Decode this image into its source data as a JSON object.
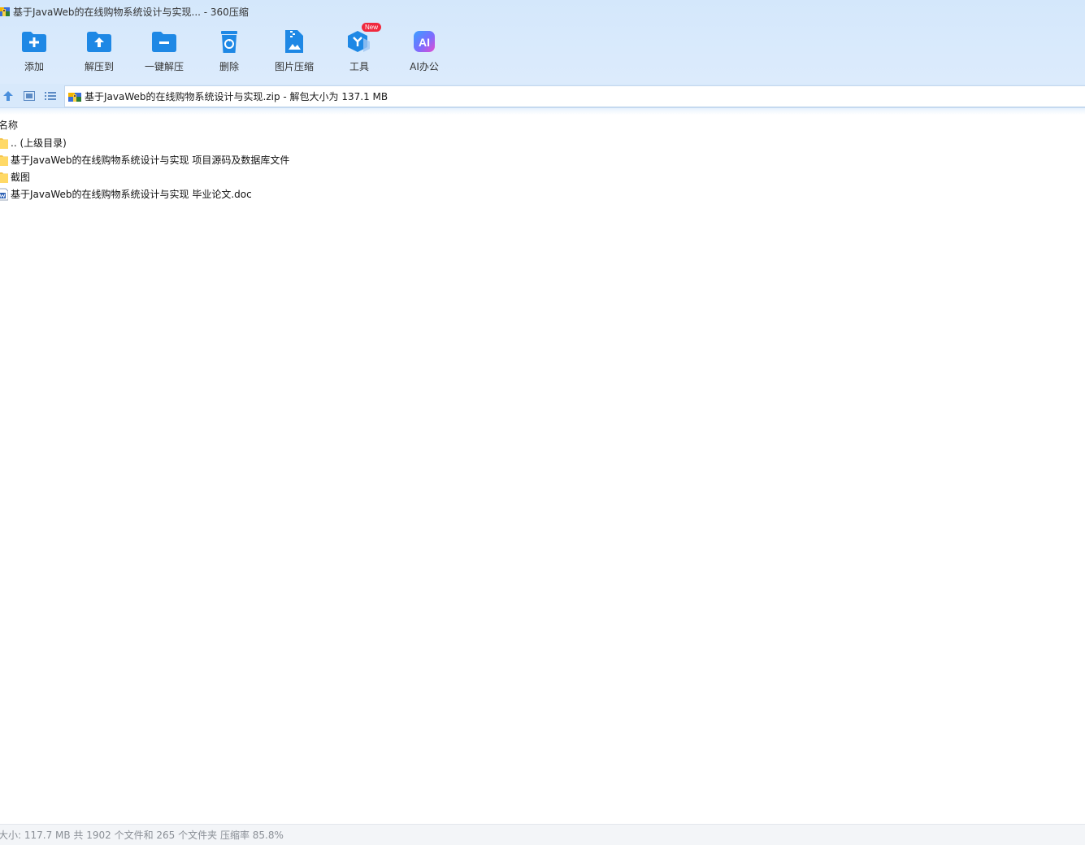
{
  "window": {
    "title": "基于JavaWeb的在线购物系统设计与实现... - 360压缩"
  },
  "toolbar": {
    "items": [
      {
        "label": "添加",
        "icon": "add-folder-icon"
      },
      {
        "label": "解压到",
        "icon": "extract-to-icon"
      },
      {
        "label": "一键解压",
        "icon": "one-click-extract-icon"
      },
      {
        "label": "删除",
        "icon": "trash-icon"
      },
      {
        "label": "图片压缩",
        "icon": "image-compress-icon"
      },
      {
        "label": "工具",
        "icon": "tools-icon",
        "badge": "New"
      },
      {
        "label": "AI办公",
        "icon": "ai-office-icon",
        "icon_text": "AI"
      }
    ]
  },
  "address": {
    "path": "基于JavaWeb的在线购物系统设计与实现.zip - 解包大小为 137.1 MB"
  },
  "list": {
    "column_name": "名称",
    "items": [
      {
        "name": ".. (上级目录)",
        "type": "folder"
      },
      {
        "name": "基于JavaWeb的在线购物系统设计与实现 项目源码及数据库文件",
        "type": "folder"
      },
      {
        "name": "截图",
        "type": "folder"
      },
      {
        "name": "基于JavaWeb的在线购物系统设计与实现 毕业论文.doc",
        "type": "doc"
      }
    ]
  },
  "status": {
    "text": "大小: 117.7 MB 共 1902 个文件和 265 个文件夹 压缩率 85.8%"
  },
  "colors": {
    "accent": "#1e88e5",
    "toolbar_bg": "#d6e8fb",
    "badge": "#f0293e"
  }
}
